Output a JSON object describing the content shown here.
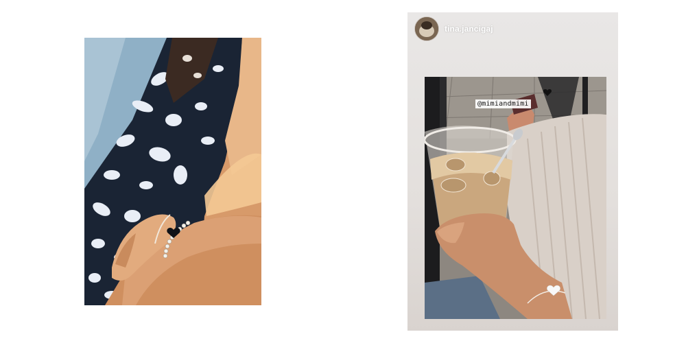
{
  "left_photo": {
    "subject": "wrist-with-beaded-bracelets"
  },
  "story": {
    "username": "tina.jancigaj",
    "mention": "@mimiandmimi",
    "mention_icon": "heart-icon",
    "colors": {
      "card_background": "#e7e3e0",
      "username_text": "#ffffff"
    }
  }
}
